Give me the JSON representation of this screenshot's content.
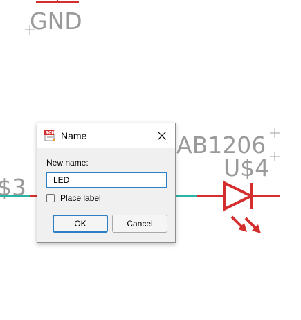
{
  "schematic": {
    "labels": {
      "gnd": "GND",
      "led_value": "AB1206",
      "led_name": "U$4",
      "left_part": "$3"
    },
    "colors": {
      "part_symbol": "#d32f2f",
      "wire": "#2bb3a3",
      "text": "#9a9a9a",
      "origin_cross": "#a0a0a0"
    }
  },
  "dialog": {
    "app_icon": "sch-icon",
    "app_icon_text": "SCH",
    "title": "Name",
    "close_icon": "close-icon",
    "field_label": "New name:",
    "field_value": "LED",
    "checkbox_label": "Place label",
    "checkbox_checked": false,
    "ok_label": "OK",
    "cancel_label": "Cancel"
  }
}
